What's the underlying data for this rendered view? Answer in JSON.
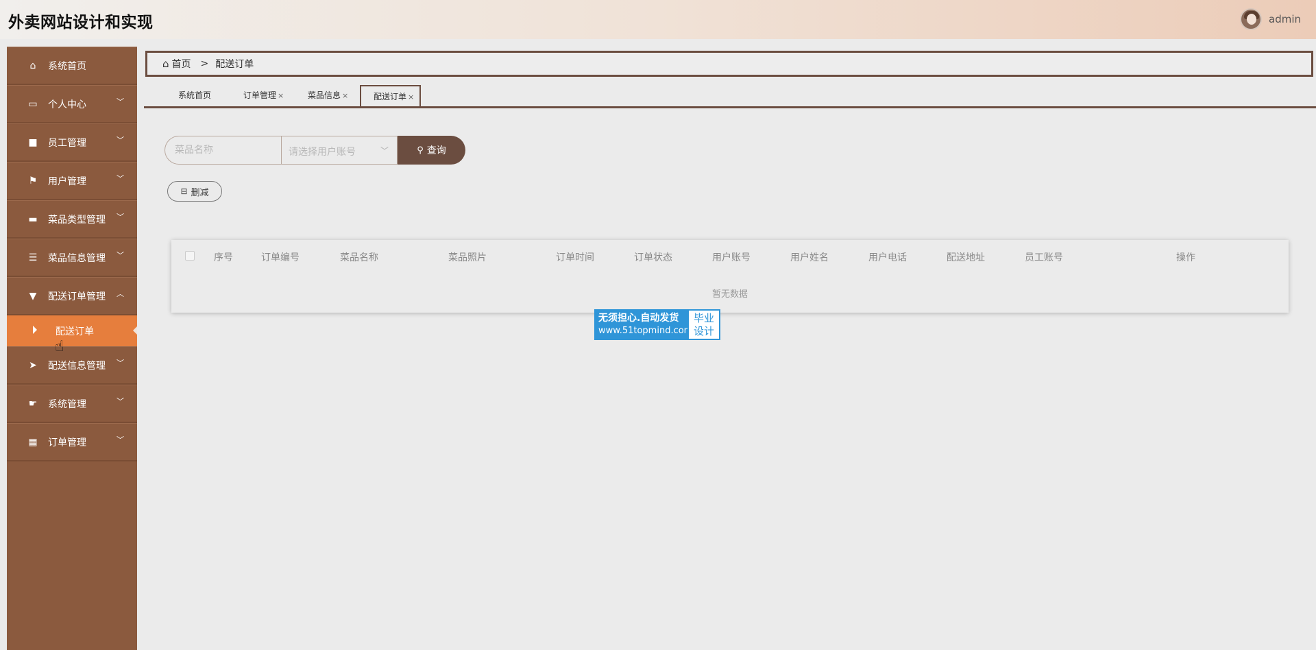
{
  "header": {
    "title": "外卖网站设计和实现",
    "username": "admin"
  },
  "sidebar": {
    "items": [
      {
        "label": "系统首页",
        "icon": "home-icon",
        "expandable": false
      },
      {
        "label": "个人中心",
        "icon": "card-icon",
        "expandable": true
      },
      {
        "label": "员工管理",
        "icon": "briefcase-icon",
        "expandable": true
      },
      {
        "label": "用户管理",
        "icon": "flag-icon",
        "expandable": true
      },
      {
        "label": "菜品类型管理",
        "icon": "tray-icon",
        "expandable": true
      },
      {
        "label": "菜品信息管理",
        "icon": "list-icon",
        "expandable": true
      },
      {
        "label": "配送订单管理",
        "icon": "stamp-icon",
        "expandable": true,
        "expanded": true
      },
      {
        "label": "配送信息管理",
        "icon": "send-icon",
        "expandable": true
      },
      {
        "label": "系统管理",
        "icon": "thumb-icon",
        "expandable": true
      },
      {
        "label": "订单管理",
        "icon": "grid-icon",
        "expandable": true
      }
    ],
    "active_sub": {
      "label": "配送订单"
    }
  },
  "breadcrumb": {
    "home": "首页",
    "separator": ">",
    "current": "配送订单"
  },
  "tabs": [
    {
      "label": "系统首页",
      "closable": false
    },
    {
      "label": "订单管理",
      "closable": true
    },
    {
      "label": "菜品信息",
      "closable": true
    },
    {
      "label": "配送订单",
      "closable": true,
      "active": true
    }
  ],
  "tab_close": "×",
  "search": {
    "dish_placeholder": "菜品名称",
    "user_placeholder": "请选择用户账号",
    "query_label": "查询"
  },
  "actions": {
    "delete_label": "删减"
  },
  "table": {
    "columns": [
      "序号",
      "订单编号",
      "菜品名称",
      "菜品照片",
      "订单时间",
      "订单状态",
      "用户账号",
      "用户姓名",
      "用户电话",
      "配送地址",
      "员工账号",
      "操作"
    ],
    "empty_text": "暂无数据"
  },
  "watermark": {
    "line1": "无须担心.自动发货",
    "line2": "www.51topmind.com",
    "right1": "毕业",
    "right2": "设计"
  },
  "colors": {
    "accent": "#6b4d40",
    "sidebar": "#8b5a3e",
    "active": "#e67e3d",
    "watermark": "#2f95d8"
  }
}
